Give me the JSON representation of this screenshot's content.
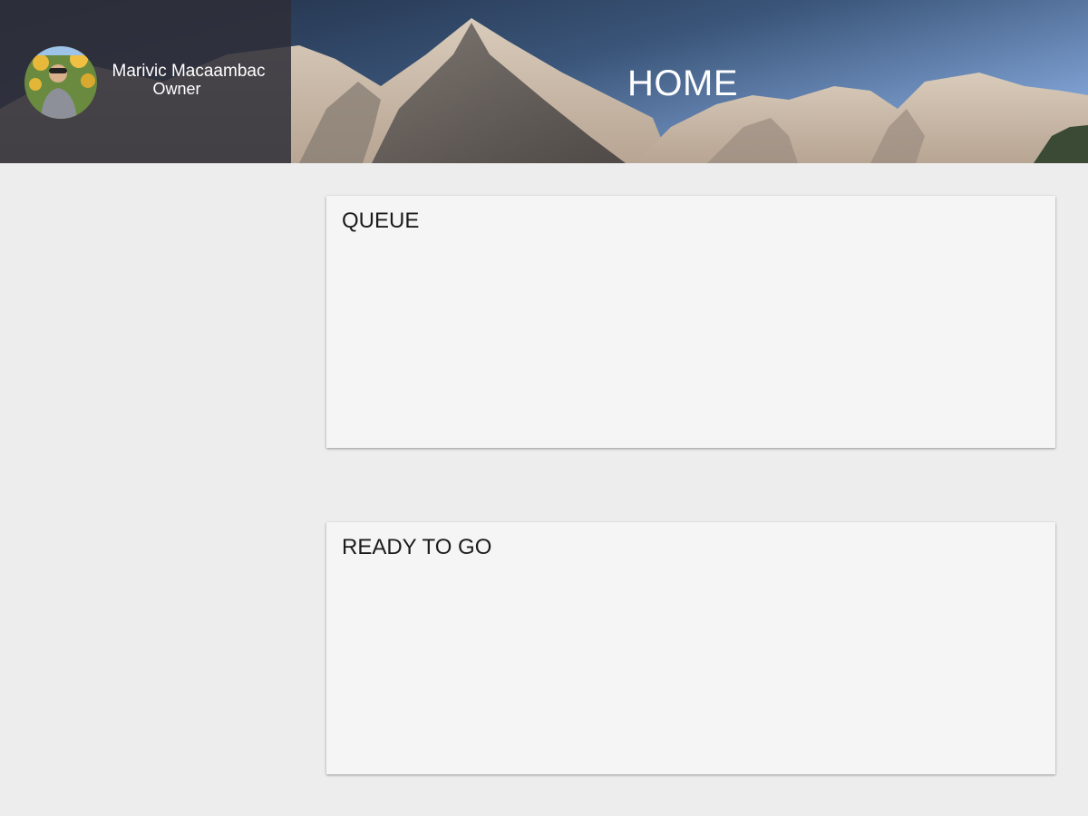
{
  "user": {
    "name": "Marivic Macaambac",
    "role": "Owner",
    "avatar_icon": "user-photo"
  },
  "header": {
    "title": "HOME",
    "background": "mountain-photo"
  },
  "cards": {
    "queue": {
      "title": "QUEUE"
    },
    "ready": {
      "title": "READY TO GO"
    }
  },
  "colors": {
    "page_background": "#ededed",
    "card_background": "#f5f5f5",
    "user_panel": "#2e2e38",
    "sky_top": "#1f2d45",
    "sky_right": "#6f93c9"
  }
}
